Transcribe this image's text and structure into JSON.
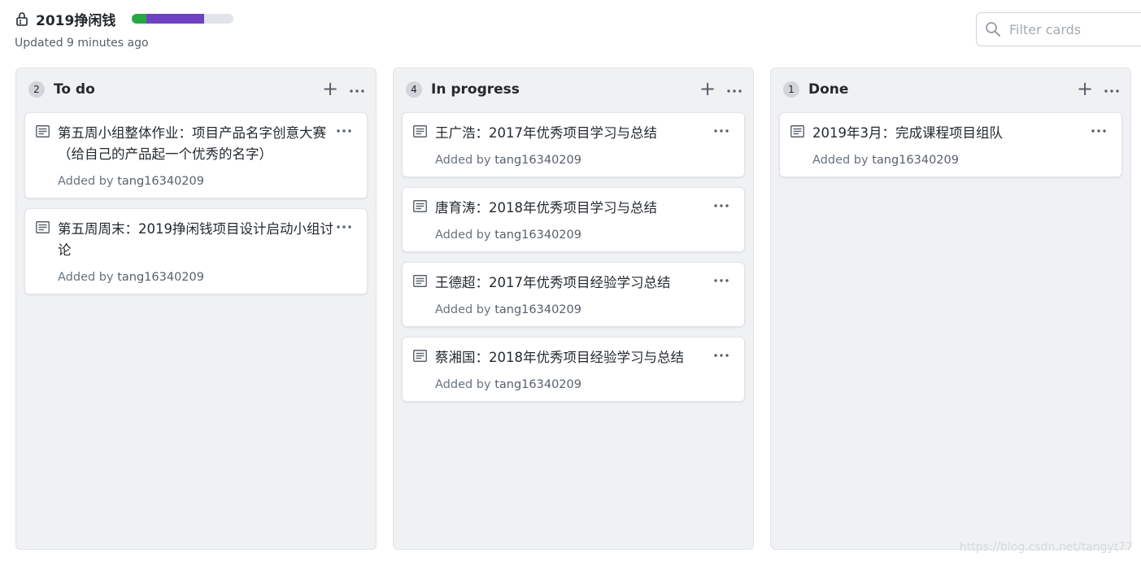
{
  "project": {
    "title": "2019挣闲钱",
    "updated": "Updated 9 minutes ago",
    "progress": {
      "done": 0.14,
      "in_progress": 0.57,
      "todo": 0.29
    },
    "colors": {
      "done": "#28a745",
      "in_progress": "#6f42c1",
      "todo": "#e1e4e8"
    }
  },
  "filter": {
    "placeholder": "Filter cards",
    "value": ""
  },
  "columns": [
    {
      "count": "2",
      "name": "To do",
      "cards": [
        {
          "title": "第五周小组整体作业：项目产品名字创意大赛（给自己的产品起一个优秀的名字）",
          "added_prefix": "Added by",
          "author": "tang16340209"
        },
        {
          "title": "第五周周末：2019挣闲钱项目设计启动小组讨论",
          "added_prefix": "Added by",
          "author": "tang16340209"
        }
      ]
    },
    {
      "count": "4",
      "name": "In progress",
      "cards": [
        {
          "title": "王广浩：2017年优秀项目学习与总结",
          "added_prefix": "Added by",
          "author": "tang16340209"
        },
        {
          "title": "唐育涛：2018年优秀项目学习与总结",
          "added_prefix": "Added by",
          "author": "tang16340209"
        },
        {
          "title": "王德超：2017年优秀项目经验学习总结",
          "added_prefix": "Added by",
          "author": "tang16340209"
        },
        {
          "title": "蔡湘国：2018年优秀项目经验学习与总结",
          "added_prefix": "Added by",
          "author": "tang16340209"
        }
      ]
    },
    {
      "count": "1",
      "name": "Done",
      "cards": [
        {
          "title": "2019年3月：完成课程项目组队",
          "added_prefix": "Added by",
          "author": "tang16340209"
        }
      ]
    }
  ],
  "icons": {
    "lock": "lock-icon",
    "search": "search-icon",
    "note": "note-icon",
    "add": "plus-icon",
    "more": "kebab-icon"
  },
  "watermark": "https://blog.csdn.net/tangyt77"
}
